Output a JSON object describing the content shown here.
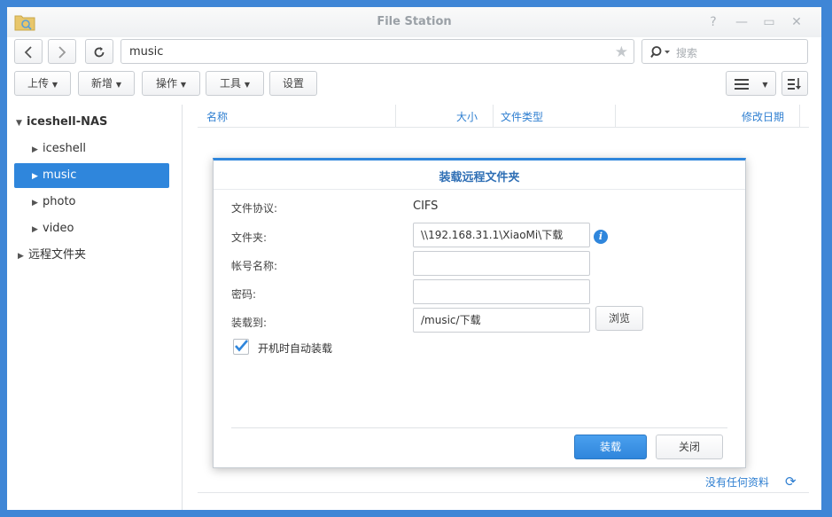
{
  "window": {
    "title": "File Station"
  },
  "toolbar": {
    "path": "music",
    "search_placeholder": "搜索",
    "upload_label": "上传",
    "new_label": "新增",
    "action_label": "操作",
    "tools_label": "工具",
    "settings_label": "设置"
  },
  "sidebar": {
    "root": "iceshell-NAS",
    "items": [
      {
        "label": "iceshell"
      },
      {
        "label": "music"
      },
      {
        "label": "photo"
      },
      {
        "label": "video"
      }
    ],
    "remote": "远程文件夹"
  },
  "list": {
    "columns": [
      "名称",
      "大小",
      "文件类型",
      "修改日期"
    ],
    "footer": "没有任何资料"
  },
  "dialog": {
    "title": "装载远程文件夹",
    "protocol_label": "文件协议:",
    "protocol_value": "CIFS",
    "folder_label": "文件夹:",
    "folder_value": "\\\\192.168.31.1\\XiaoMi\\下载",
    "account_label": "帐号名称:",
    "account_value": "",
    "password_label": "密码:",
    "password_value": "",
    "mount_label": "装载到:",
    "mount_value": "/music/下载",
    "browse_label": "浏览",
    "automount_label": "开机时自动装载",
    "automount_checked": true,
    "mount_button": "装载",
    "close_button": "关闭"
  },
  "colors": {
    "accent": "#2f86dc",
    "frame": "#3f86d6"
  }
}
